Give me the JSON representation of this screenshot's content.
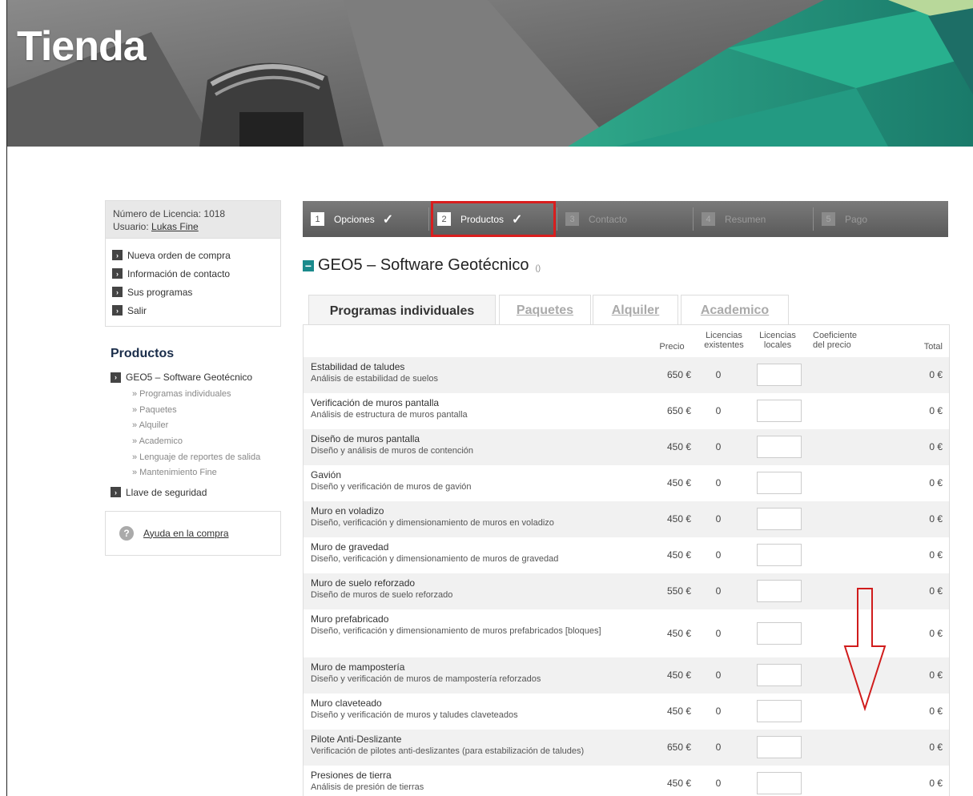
{
  "banner": {
    "title": "Tienda"
  },
  "sidebar": {
    "license_label": "Número de Licencia: 1018",
    "user_prefix": "Usuario: ",
    "user_name": "Lukas Fine",
    "menu": [
      "Nueva orden de compra",
      "Información de contacto",
      "Sus programas",
      "Salir"
    ],
    "products_title": "Productos",
    "product_main": "GEO5 – Software Geotécnico",
    "product_sub": [
      "» Programas individuales",
      "» Paquetes",
      "» Alquiler",
      "» Academico",
      "» Lenguaje de reportes de salida",
      "» Mantenimiento Fine"
    ],
    "security_key": "Llave de seguridad",
    "help": "Ayuda en la compra"
  },
  "steps": [
    {
      "num": "1",
      "label": "Opciones",
      "done": true
    },
    {
      "num": "2",
      "label": "Productos",
      "done": true
    },
    {
      "num": "3",
      "label": "Contacto",
      "done": false
    },
    {
      "num": "4",
      "label": "Resumen",
      "done": false
    },
    {
      "num": "5",
      "label": "Pago",
      "done": false
    }
  ],
  "section": {
    "title": "GEO5 – Software Geotécnico",
    "count": "()"
  },
  "tabs": [
    "Programas individuales",
    "Paquetes",
    "Alquiler",
    "Academico"
  ],
  "table": {
    "headers": {
      "price": "Precio",
      "existing_1": "Licencias",
      "existing_2": "existentes",
      "local_1": "Licencias",
      "local_2": "locales",
      "coef_1": "Coeficiente",
      "coef_2": "del precio",
      "total": "Total"
    },
    "rows": [
      {
        "name": "Estabilidad de taludes",
        "desc": "Análisis de estabilidad de suelos",
        "price": "650 €",
        "existing": "0",
        "total": "0 €"
      },
      {
        "name": "Verificación de muros pantalla",
        "desc": "Análisis de estructura de muros pantalla",
        "price": "650 €",
        "existing": "0",
        "total": "0 €"
      },
      {
        "name": "Diseño de muros pantalla",
        "desc": "Diseño y análisis de muros de contención",
        "price": "450 €",
        "existing": "0",
        "total": "0 €"
      },
      {
        "name": "Gavión",
        "desc": "Diseño y verificación de muros de gavión",
        "price": "450 €",
        "existing": "0",
        "total": "0 €"
      },
      {
        "name": "Muro en voladizo",
        "desc": "Diseño, verificación y dimensionamiento de muros en voladizo",
        "price": "450 €",
        "existing": "0",
        "total": "0 €"
      },
      {
        "name": "Muro de gravedad",
        "desc": "Diseño, verificación y dimensionamiento de muros de gravedad",
        "price": "450 €",
        "existing": "0",
        "total": "0 €"
      },
      {
        "name": "Muro de suelo reforzado",
        "desc": "Diseño de muros de suelo reforzado",
        "price": "550 €",
        "existing": "0",
        "total": "0 €"
      },
      {
        "name": "Muro prefabricado",
        "desc": "Diseño, verificación y dimensionamiento de muros prefabricados [bloques]",
        "price": "450 €",
        "existing": "0",
        "total": "0 €"
      },
      {
        "name": "Muro de mampostería",
        "desc": "Diseño y verificación de muros de mampostería reforzados",
        "price": "450 €",
        "existing": "0",
        "total": "0 €"
      },
      {
        "name": "Muro claveteado",
        "desc": "Diseño y verificación de muros y taludes claveteados",
        "price": "450 €",
        "existing": "0",
        "total": "0 €"
      },
      {
        "name": "Pilote Anti-Deslizante",
        "desc": "Verificación de pilotes anti-deslizantes (para estabilización de taludes)",
        "price": "650 €",
        "existing": "0",
        "total": "0 €"
      },
      {
        "name": "Presiones de tierra",
        "desc": "Análisis de presión de tierras",
        "price": "450 €",
        "existing": "0",
        "total": "0 €"
      }
    ]
  },
  "colors": {
    "accent": "#1a8a8c",
    "highlight": "#d91e1e",
    "annotation_arrow": "#d01c1c"
  }
}
